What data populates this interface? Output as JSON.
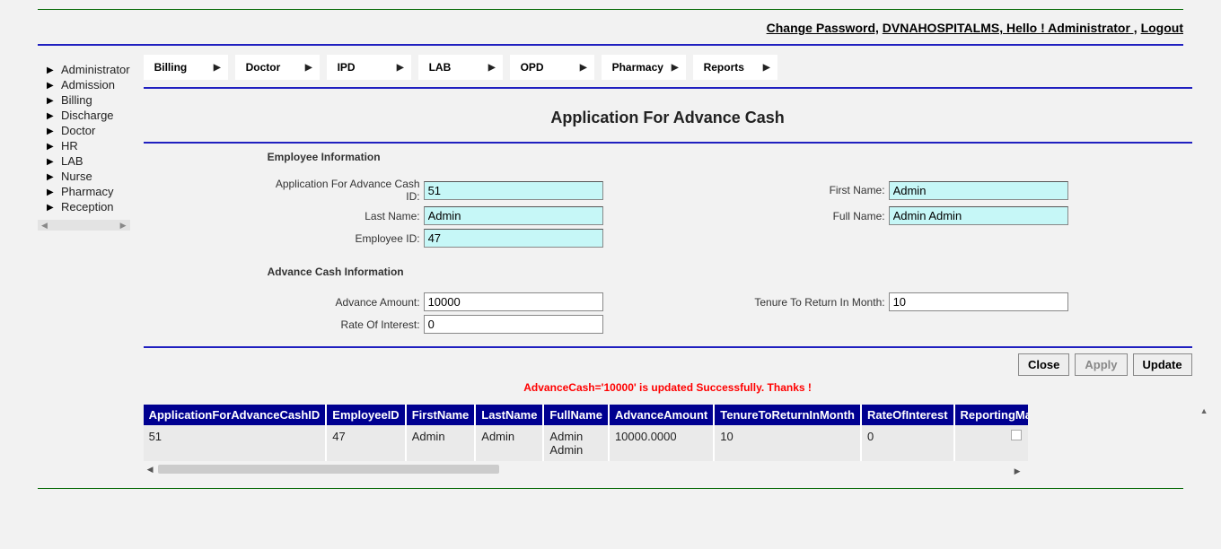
{
  "topbar": {
    "change_password": "Change Password,",
    "brand": "DVNAHOSPITALMS, Hello ! Administrator ,",
    "logout": "Logout"
  },
  "sidebar": {
    "items": [
      {
        "label": "Administrator"
      },
      {
        "label": "Admission"
      },
      {
        "label": "Billing"
      },
      {
        "label": "Discharge"
      },
      {
        "label": "Doctor"
      },
      {
        "label": "HR"
      },
      {
        "label": "LAB"
      },
      {
        "label": "Nurse"
      },
      {
        "label": "Pharmacy"
      },
      {
        "label": "Reception"
      }
    ]
  },
  "menu": {
    "items": [
      {
        "label": "Billing"
      },
      {
        "label": "Doctor"
      },
      {
        "label": "IPD"
      },
      {
        "label": "LAB"
      },
      {
        "label": "OPD"
      },
      {
        "label": "Pharmacy"
      },
      {
        "label": "Reports"
      }
    ]
  },
  "page": {
    "title": "Application For Advance Cash"
  },
  "form": {
    "section1": "Employee Information",
    "section2": "Advance Cash Information",
    "labels": {
      "app_id": "Application For Advance Cash ID:",
      "first_name": "First Name:",
      "last_name": "Last Name:",
      "full_name": "Full Name:",
      "employee_id": "Employee ID:",
      "advance_amount": "Advance Amount:",
      "tenure": "Tenure To Return In Month:",
      "rate": "Rate Of Interest:"
    },
    "values": {
      "app_id": "51",
      "first_name": "Admin",
      "last_name": "Admin",
      "full_name": "Admin Admin",
      "employee_id": "47",
      "advance_amount": "10000",
      "tenure": "10",
      "rate": "0"
    }
  },
  "buttons": {
    "close": "Close",
    "apply": "Apply",
    "update": "Update"
  },
  "status": "AdvanceCash='10000' is updated Successfully. Thanks !",
  "table": {
    "headers": [
      "ApplicationForAdvanceCashID",
      "EmployeeID",
      "FirstName",
      "LastName",
      "FullName",
      "AdvanceAmount",
      "TenureToReturnInMonth",
      "RateOfInterest",
      "ReportingManagerA"
    ],
    "rows": [
      {
        "app_id": "51",
        "emp_id": "47",
        "first": "Admin",
        "last": "Admin",
        "full": "Admin Admin",
        "amount": "10000.0000",
        "tenure": "10",
        "rate": "0",
        "approved": false
      }
    ]
  }
}
